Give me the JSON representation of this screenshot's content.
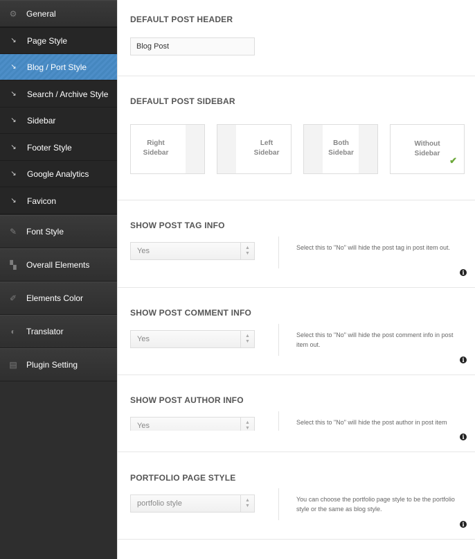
{
  "sidebar": {
    "general": "General",
    "sub_items": [
      "Page Style",
      "Blog / Port Style",
      "Search / Archive Style",
      "Sidebar",
      "Footer Style",
      "Google Analytics",
      "Favicon"
    ],
    "font_style": "Font Style",
    "overall_elements": "Overall Elements",
    "elements_color": "Elements Color",
    "translator": "Translator",
    "plugin_setting": "Plugin Setting",
    "accent_color": "#4a8bc4"
  },
  "header_section": {
    "title": "DEFAULT POST HEADER",
    "value": "Blog Post"
  },
  "sidebar_section": {
    "title": "DEFAULT POST SIDEBAR",
    "options": [
      {
        "line1": "Right",
        "line2": "Sidebar"
      },
      {
        "line1": "Left",
        "line2": "Sidebar"
      },
      {
        "line1": "Both",
        "line2": "Sidebar"
      },
      {
        "line1": "Without",
        "line2": "Sidebar"
      }
    ],
    "selected": "Without Sidebar"
  },
  "tag_section": {
    "title": "SHOW POST TAG INFO",
    "value": "Yes",
    "desc": "Select this to \"No\" will hide the post tag in post item out."
  },
  "comment_section": {
    "title": "SHOW POST COMMENT INFO",
    "value": "Yes",
    "desc": "Select this to \"No\" will hide the post comment info in post item out."
  },
  "author_section": {
    "title": "SHOW POST AUTHOR INFO",
    "value": "Yes",
    "desc": "Select this to \"No\" will hide the post author in post item"
  },
  "portfolio_section": {
    "title": "PORTFOLIO PAGE STYLE",
    "value": "portfolio style",
    "desc": "You can choose the portfolio page style to be the portfolio style or the same as blog style."
  }
}
